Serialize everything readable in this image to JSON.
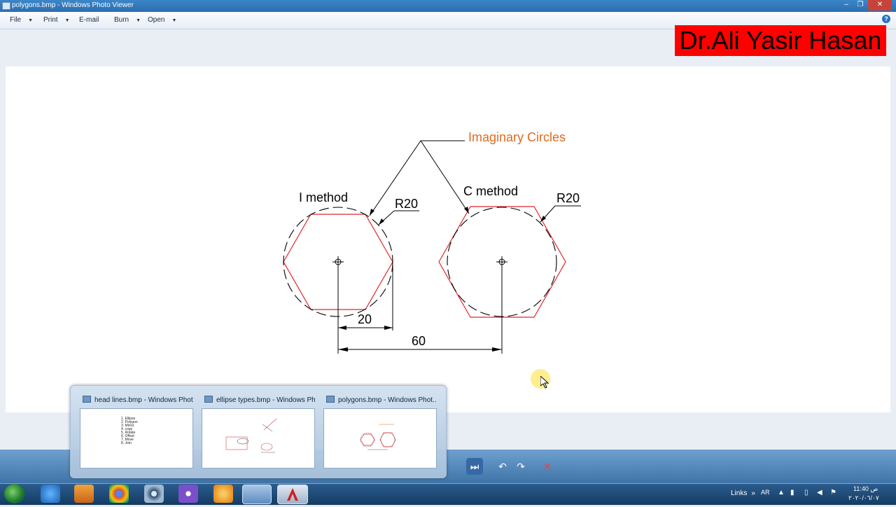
{
  "window": {
    "title": "polygons.bmp - Windows Photo Viewer",
    "controls": [
      "–",
      "❐",
      "✕"
    ]
  },
  "menu": {
    "items": [
      {
        "label": "File",
        "has_dropdown": true
      },
      {
        "label": "Print",
        "has_dropdown": true
      },
      {
        "label": "E-mail",
        "has_dropdown": false
      },
      {
        "label": "Burn",
        "has_dropdown": true
      },
      {
        "label": "Open",
        "has_dropdown": true
      }
    ],
    "help_glyph": "?"
  },
  "author_label": "Dr.Ali Yasir Hasan",
  "drawing": {
    "callout_label": "Imaginary Circles",
    "left_label": "I method",
    "right_label": "C method",
    "left_radius": "R20",
    "right_radius": "R20",
    "dim_small": "20",
    "dim_large": "60",
    "colors": {
      "polygon": "#e0262b",
      "callout": "#e06a1f",
      "ink": "#000000"
    }
  },
  "thumbnails": [
    {
      "title": "head lines.bmp - Windows Phot...",
      "list": [
        "1.    Ellipse",
        "2.    Polygon",
        "3.    Mirror",
        "4.    copy",
        "5.    Rotate",
        "6.    Offset",
        "7.    Move",
        "8.    Join"
      ]
    },
    {
      "title": "ellipse types.bmp - Windows Ph..."
    },
    {
      "title": "polygons.bmp - Windows Phot..."
    }
  ],
  "media_controls": [
    "⏭",
    "↶",
    "↷",
    "✕"
  ],
  "taskbar": {
    "links": "Links",
    "chevron": "»",
    "language": "AR",
    "time": "11:40 ص",
    "date": "٢٠٢٠/٠٦/٠٧"
  }
}
